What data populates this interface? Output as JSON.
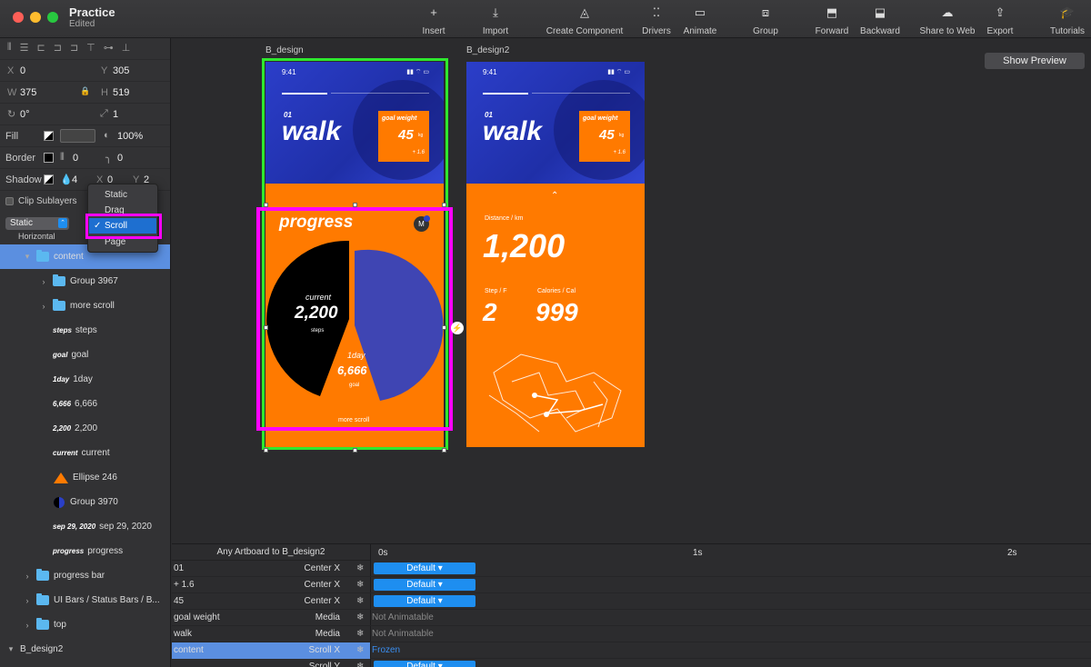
{
  "app": {
    "title": "Practice",
    "subtitle": "Edited"
  },
  "toolbar": [
    {
      "label": "Insert",
      "icon": "+"
    },
    {
      "label": "Import",
      "icon": "⤓"
    },
    {
      "label": "Create Component",
      "icon": "◬"
    },
    {
      "label": "Drivers",
      "icon": "⁚⁚"
    },
    {
      "label": "Animate",
      "icon": "▭"
    },
    {
      "label": "Group",
      "icon": "⧈"
    },
    {
      "label": "Forward",
      "icon": "⬒"
    },
    {
      "label": "Backward",
      "icon": "⬓"
    },
    {
      "label": "Share to Web",
      "icon": "☁"
    },
    {
      "label": "Export",
      "icon": "⇪"
    },
    {
      "label": "Tutorials",
      "icon": "🎓"
    }
  ],
  "inspector": {
    "x_label": "X",
    "x": "0",
    "y_label": "Y",
    "y": "305",
    "w_label": "W",
    "w": "375",
    "h_label": "H",
    "h": "519",
    "rotation": "0°",
    "scale": "1",
    "fill_label": "Fill",
    "opacity": "100%",
    "border_label": "Border",
    "border_width": "0",
    "radius": "0",
    "shadow_label": "Shadow",
    "shadow_blur": "4",
    "shadow_x_label": "X",
    "shadow_x": "0",
    "shadow_y_label": "Y",
    "shadow_y": "2",
    "clip_label": "Clip Sublayers",
    "scroll_select": "Static",
    "scroll_direction": "Horizontal"
  },
  "dropdown": {
    "options": [
      "Static",
      "Drag",
      "Scroll",
      "Page"
    ],
    "selected": "Scroll",
    "check": "✓"
  },
  "layers": [
    {
      "name": "content",
      "type": "folder",
      "indent": 1,
      "chev": "▾",
      "selected": true
    },
    {
      "name": "Group 3967",
      "type": "folder",
      "indent": 2,
      "chev": "›"
    },
    {
      "name": "more scroll",
      "type": "folder",
      "indent": 2,
      "chev": "›"
    },
    {
      "name": "steps",
      "type": "text",
      "thumb": "steps",
      "indent": 2
    },
    {
      "name": "goal",
      "type": "text",
      "thumb": "goal",
      "indent": 2
    },
    {
      "name": "1day",
      "type": "text",
      "thumb": "1day",
      "indent": 2
    },
    {
      "name": "6,666",
      "type": "text",
      "thumb": "6,666",
      "indent": 2
    },
    {
      "name": "2,200",
      "type": "text",
      "thumb": "2,200",
      "indent": 2
    },
    {
      "name": "current",
      "type": "text",
      "thumb": "current",
      "indent": 2
    },
    {
      "name": "Ellipse 246",
      "type": "ellipse",
      "indent": 2
    },
    {
      "name": "Group 3970",
      "type": "group",
      "indent": 2
    },
    {
      "name": "sep 29, 2020",
      "type": "text",
      "thumb": "sep 29, 2020",
      "indent": 2
    },
    {
      "name": "progress",
      "type": "text",
      "thumb": "progress",
      "indent": 2
    },
    {
      "name": "progress bar",
      "type": "folder",
      "indent": 1,
      "chev": "›"
    },
    {
      "name": "UI Bars / Status Bars / B...",
      "type": "folder",
      "indent": 1,
      "chev": "›"
    },
    {
      "name": "top",
      "type": "folder",
      "indent": 1,
      "chev": "›"
    },
    {
      "name": "B_design2",
      "type": "artboard",
      "indent": 0,
      "chev": "▾"
    }
  ],
  "canvas": {
    "show_preview": "Show Preview",
    "artboard1": {
      "label": "B_design",
      "time": "9:41",
      "number": "01",
      "title": "walk",
      "goal_label": "goal weight",
      "goal_value": "45",
      "goal_unit": "kg",
      "goal_delta": "+ 1.6",
      "progress": "progress",
      "current_label": "current",
      "current_value": "2,200",
      "current_unit": "steps",
      "day_label": "1day",
      "day_value": "6,666",
      "day_unit": "goal",
      "more": "more scroll",
      "avatar": "M"
    },
    "artboard2": {
      "label": "B_design2",
      "time": "9:41",
      "number": "01",
      "title": "walk",
      "goal_label": "goal weight",
      "goal_value": "45",
      "goal_unit": "kg",
      "goal_delta": "+ 1.6",
      "arrow": "⌃",
      "distance_label": "Distance / km",
      "distance_value": "1,200",
      "step_label": "Step / F",
      "step_value": "2",
      "cal_label": "Calories / Cal",
      "cal_value": "999"
    }
  },
  "timeline": {
    "header": "Any Artboard to B_design2",
    "ticks": [
      "0s",
      "1s",
      "2s"
    ],
    "rows": [
      {
        "name": "01",
        "prop": "Center X",
        "value": "Default ▾",
        "kind": "pill"
      },
      {
        "name": "+ 1.6",
        "prop": "Center X",
        "value": "Default ▾",
        "kind": "pill"
      },
      {
        "name": "45",
        "prop": "Center X",
        "value": "Default ▾",
        "kind": "pill"
      },
      {
        "name": "goal weight",
        "prop": "Media",
        "value": "Not Animatable",
        "kind": "text"
      },
      {
        "name": "walk",
        "prop": "Media",
        "value": "Not Animatable",
        "kind": "text"
      },
      {
        "name": "content",
        "prop": "Scroll X",
        "value": "Frozen",
        "kind": "frozen"
      },
      {
        "name": "",
        "prop": "Scroll Y",
        "value": "Default ▾",
        "kind": "pill"
      }
    ]
  },
  "colors": {
    "accent": "#1e8ef0",
    "orange": "#ff7a00",
    "blue": "#2a3fc7",
    "green": "#2ee82e",
    "magenta": "#ff00ff"
  }
}
